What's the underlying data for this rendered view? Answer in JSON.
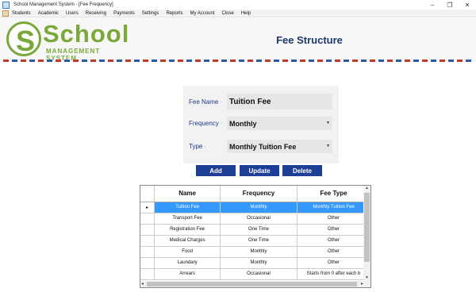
{
  "window": {
    "title": "School Management System - [Fee Frequency]",
    "controls": [
      "–",
      "❐",
      "✕"
    ]
  },
  "menu": [
    "Students",
    "Academic",
    "Users",
    "Receiving",
    "Payments",
    "Settings",
    "Reports",
    "My Account",
    "Close",
    "Help"
  ],
  "logo": {
    "letter": "S",
    "word": "School",
    "sub": "MANAGEMENT SYSTEM"
  },
  "page_title": "Fee Structure",
  "form": {
    "fee_name_label": "Fee Name",
    "fee_name_value": "Tuition Fee",
    "frequency_label": "Frequency",
    "frequency_value": "Monthly",
    "type_label": "Type",
    "type_value": "Monthly Tuition Fee"
  },
  "buttons": {
    "add": "Add",
    "update": "Update",
    "delete": "Delete"
  },
  "grid": {
    "columns": [
      "Name",
      "Frequency",
      "Fee Type"
    ],
    "rows": [
      [
        "Tuition Fee",
        "Monthly",
        "Monthly Tuition Fee"
      ],
      [
        "Transport Fee",
        "Occasional",
        "Other"
      ],
      [
        "Registration Fee",
        "One Time",
        "Other"
      ],
      [
        "Medical Charges",
        "One Time",
        "Other"
      ],
      [
        "Food",
        "Monthly",
        "Other"
      ],
      [
        "Laundary",
        "Monthly",
        "Other"
      ],
      [
        "Arrears",
        "Occasional",
        "Starts from 0 after each b"
      ]
    ],
    "selected_row": 0
  },
  "colors": {
    "brand_green": "#7aa83a",
    "title_navy": "#1e3a6e",
    "button_blue": "#1e3f96",
    "selection_blue": "#3399ff"
  }
}
